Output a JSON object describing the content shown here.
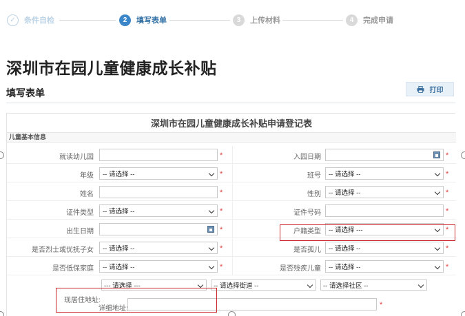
{
  "steps": [
    {
      "num": "✓",
      "label": "条件自检",
      "state": "done"
    },
    {
      "num": "2",
      "label": "填写表单",
      "state": "active"
    },
    {
      "num": "3",
      "label": "上传材料",
      "state": "todo"
    },
    {
      "num": "4",
      "label": "完成申请",
      "state": "todo"
    }
  ],
  "page_title": "深圳市在园儿童健康成长补贴",
  "section_title": "填写表单",
  "print_button": "打印",
  "sheet_title": "深圳市在园儿童健康成长补贴申请登记表",
  "group_header": "儿童基本信息",
  "rows": [
    {
      "left": {
        "label": "就读幼儿园",
        "value": ""
      },
      "right": {
        "label": "入园日期",
        "value": ""
      }
    },
    {
      "left": {
        "label": "年级",
        "value": "-- 请选择 --"
      },
      "right": {
        "label": "班号",
        "value": "-- 请选择 --"
      }
    },
    {
      "left": {
        "label": "姓名",
        "value": ""
      },
      "right": {
        "label": "性别",
        "value": "-- 请选择 --"
      }
    },
    {
      "left": {
        "label": "证件类型",
        "value": "-- 请选择 --"
      },
      "right": {
        "label": "证件号码",
        "value": ""
      }
    },
    {
      "left": {
        "label": "出生日期",
        "value": ""
      },
      "right": {
        "label": "户籍类型",
        "value": "-- 请选择 ---"
      }
    },
    {
      "left": {
        "label": "是否烈士或优抚子女",
        "value": "-- 请选择 --"
      },
      "right": {
        "label": "是否孤儿",
        "value": "-- 请选择 --"
      }
    },
    {
      "left": {
        "label": "是否低保家庭",
        "value": "-- 请选择 --"
      },
      "right": {
        "label": "是否残疾儿童",
        "value": "-- 请选择 --"
      }
    }
  ],
  "required_mark": "*",
  "address": {
    "label": "现居住地址:",
    "district": "--- 请选择 ---",
    "street": "-- 请选择街道 --",
    "community": "-- 请选择社区 --",
    "detail_label": "详细地址:",
    "detail_value": ""
  }
}
